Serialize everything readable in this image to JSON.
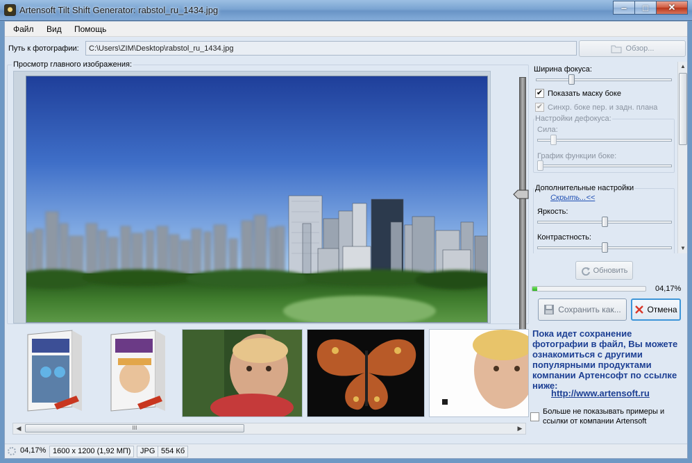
{
  "window": {
    "title": "Artensoft Tilt Shift Generator: rabstol_ru_1434.jpg"
  },
  "menu": {
    "items": [
      "Файл",
      "Вид",
      "Помощь"
    ]
  },
  "path": {
    "label": "Путь к фотографии:",
    "value": "C:\\Users\\ZIM\\Desktop\\rabstol_ru_1434.jpg",
    "browse_label": "Обзор..."
  },
  "preview": {
    "label": "Просмотр главного изображения:"
  },
  "thumbnails": {
    "scroll_grip": "III"
  },
  "settings": {
    "focus_width_label": "Ширина фокуса:",
    "focus_width_value": 0.25,
    "show_mask_label": "Показать маску боке",
    "show_mask_checked": "✔",
    "sync_label": "Синхр. боке пер. и задн. плана",
    "sync_checked": "✔",
    "defocus_group": "Настройки дефокуса:",
    "strength_label": "Сила:",
    "strength_value": 0.1,
    "bokeh_graph_label": "График функции боке:",
    "bokeh_graph_value": 0.0,
    "extra_group": "Дополнительные настройки",
    "hide_link": "Скрыть...<<",
    "brightness_label": "Яркость:",
    "brightness_value": 0.5,
    "contrast_label": "Контрастность:",
    "contrast_value": 0.5
  },
  "actions": {
    "refresh_label": "Обновить",
    "progress_fraction": 0.0417,
    "progress_text": "04,17%",
    "save_label": "Сохранить как...",
    "cancel_label": "Отмена"
  },
  "promo": {
    "text": "Пока идет сохранение фотографии в файл, Вы можете ознакомиться с другими популярными продуктами компании Артенсофт по ссылке ниже:",
    "link": "http://www.artensoft.ru",
    "dont_show_label": "Больше не показывать примеры  и ссылки от компании Artensoft"
  },
  "status": {
    "progress": "04,17%",
    "dimensions": "1600 x 1200 (1,92 МП)",
    "format": "JPG",
    "size": "554 Кб"
  },
  "colors": {
    "accent": "#1c3f93",
    "progress": "#2fb41f",
    "cancel_icon": "#d8372a"
  }
}
